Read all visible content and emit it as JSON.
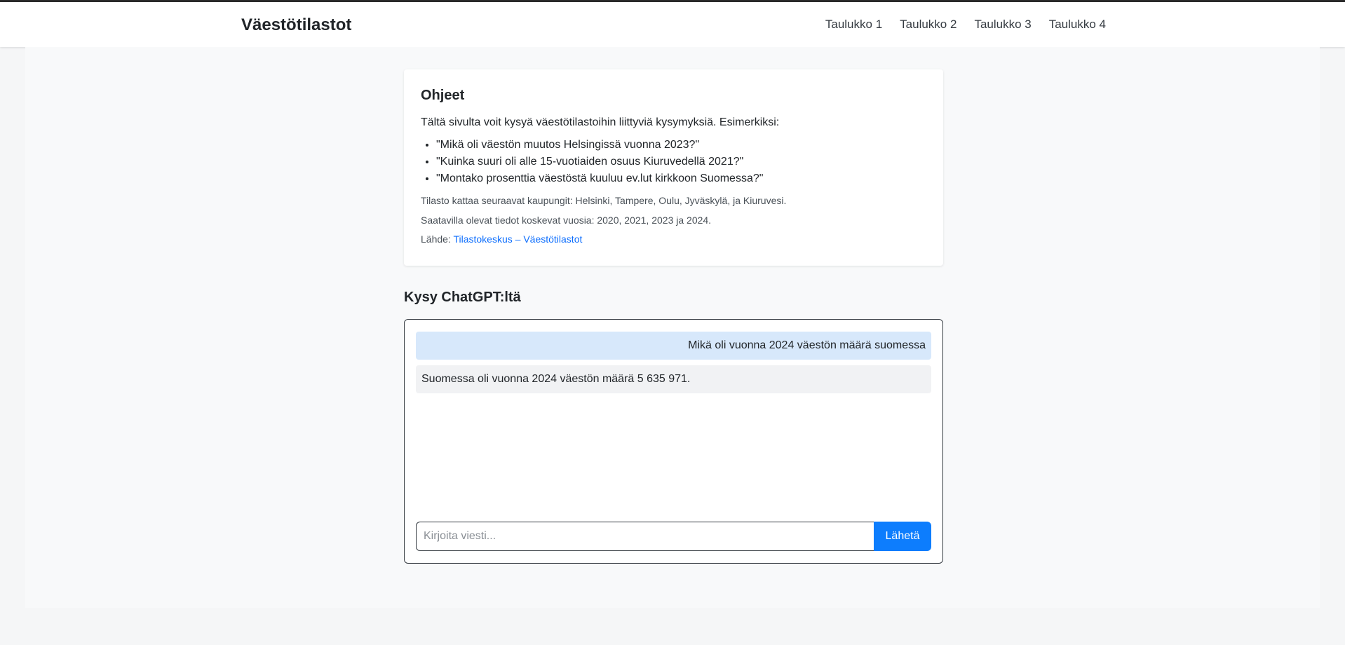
{
  "navbar": {
    "brand": "Väestötilastot",
    "links": [
      "Taulukko 1",
      "Taulukko 2",
      "Taulukko 3",
      "Taulukko 4"
    ]
  },
  "instructions": {
    "title": "Ohjeet",
    "intro": "Tältä sivulta voit kysyä väestötilastoihin liittyviä kysymyksiä. Esimerkiksi:",
    "examples": [
      "\"Mikä oli väestön muutos Helsingissä vuonna 2023?\"",
      "\"Kuinka suuri oli alle 15-vuotiaiden osuus Kiuruvedellä 2021?\"",
      "\"Montako prosenttia väestöstä kuuluu ev.lut kirkkoon Suomessa?\""
    ],
    "cities_note": "Tilasto kattaa seuraavat kaupungit: Helsinki, Tampere, Oulu, Jyväskylä, ja Kiuruvesi.",
    "years_note": "Saatavilla olevat tiedot koskevat vuosia: 2020, 2021, 2023 ja 2024.",
    "source_label": "Lähde:",
    "source_link": "Tilastokeskus – Väestötilastot"
  },
  "chat": {
    "title": "Kysy ChatGPT:ltä",
    "messages": [
      {
        "role": "user",
        "text": "Mikä oli vuonna 2024 väestön määrä suomessa"
      },
      {
        "role": "assistant",
        "text": "Suomessa oli vuonna 2024 väestön määrä 5 635 971."
      }
    ],
    "input_placeholder": "Kirjoita viesti...",
    "input_value": "",
    "send_label": "Lähetä"
  },
  "colors": {
    "accent": "#0d7dfd",
    "user_bubble": "#d7e8fb",
    "bot_bubble": "#f1f2f4",
    "link": "#0d6efd"
  }
}
